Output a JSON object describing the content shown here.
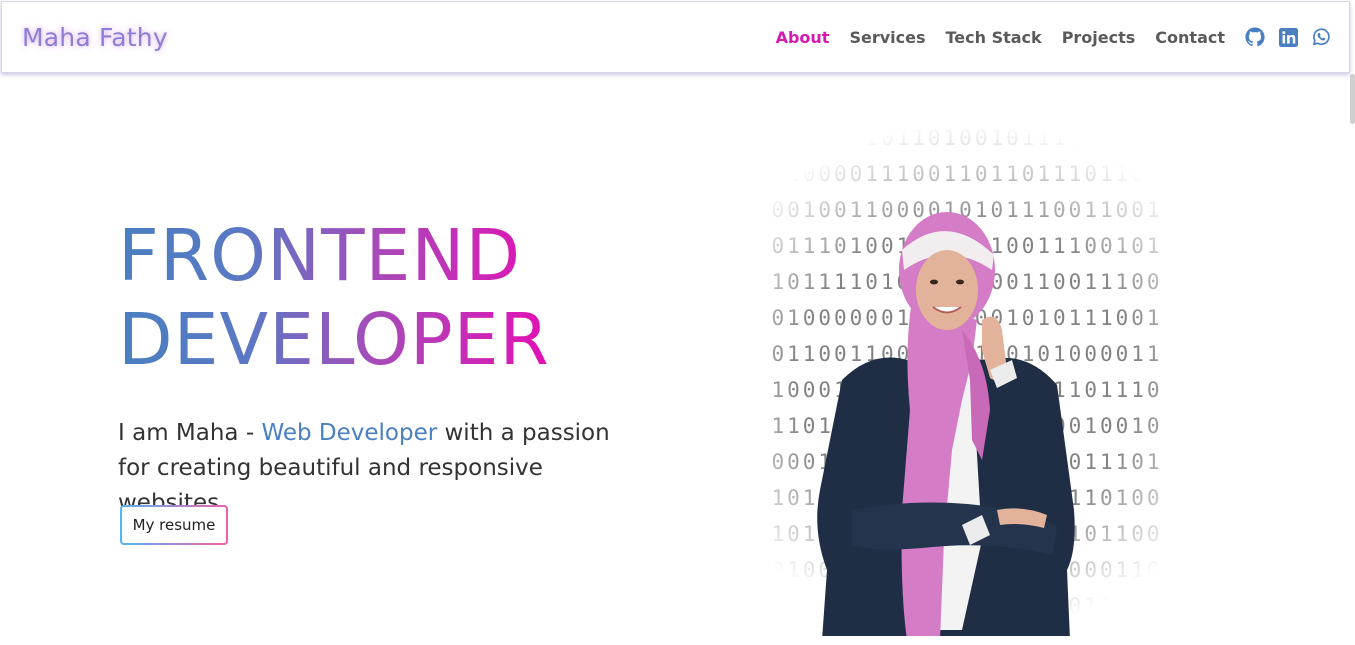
{
  "brand": {
    "name": "Maha Fathy"
  },
  "nav": {
    "links": [
      {
        "label": "About",
        "active": true
      },
      {
        "label": "Services",
        "active": false
      },
      {
        "label": "Tech Stack",
        "active": false
      },
      {
        "label": "Projects",
        "active": false
      },
      {
        "label": "Contact",
        "active": false
      }
    ],
    "socials": [
      "github-icon",
      "linkedin-icon",
      "whatsapp-icon"
    ]
  },
  "hero": {
    "title_line1": "FRONTEND",
    "title_line2": "DEVELOPER",
    "desc_prefix": "I am Maha - ",
    "desc_highlight": "Web Developer",
    "desc_suffix": " with a passion for creating beautiful and responsive websites.",
    "resume_label": "My resume"
  },
  "colors": {
    "accent_pink": "#d41ab0",
    "accent_blue": "#4a7fc0",
    "nav_text": "#5a5a5a",
    "brand": "#8c7fd6"
  }
}
